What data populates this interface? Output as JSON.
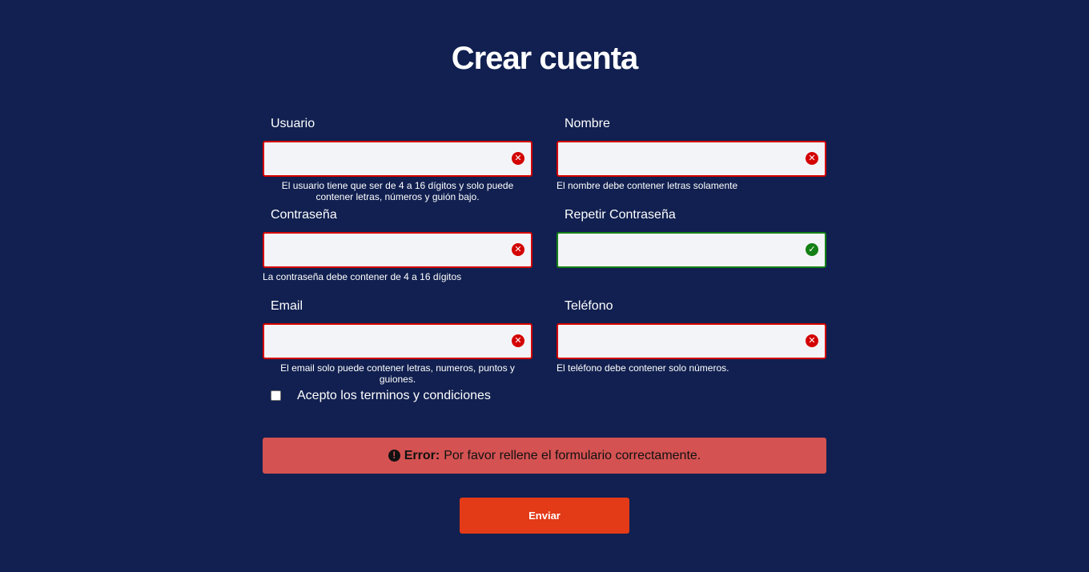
{
  "page": {
    "title": "Crear cuenta"
  },
  "fields": {
    "usuario": {
      "label": "Usuario",
      "value": "",
      "hint": "El usuario tiene que ser de 4 a 16 dígitos y solo puede contener letras, números y guión bajo.",
      "status": "error"
    },
    "nombre": {
      "label": "Nombre",
      "value": "",
      "hint": "El nombre debe contener letras solamente",
      "status": "error"
    },
    "password": {
      "label": "Contraseña",
      "value": "",
      "hint": "La contraseña debe contener de 4 a 16 dígitos",
      "status": "error"
    },
    "password2": {
      "label": "Repetir Contraseña",
      "value": "",
      "status": "valid"
    },
    "email": {
      "label": "Email",
      "value": "",
      "hint": "El email solo puede contener letras, numeros, puntos y guiones.",
      "status": "error"
    },
    "telefono": {
      "label": "Teléfono",
      "value": "",
      "hint": "El teléfono debe contener solo números.",
      "status": "error"
    }
  },
  "terms": {
    "label": "Acepto los terminos y condiciones",
    "checked": false
  },
  "error_message": {
    "icon": "exclamation-circle-icon",
    "label": "Error:",
    "text": "Por favor rellene el formulario correctamente."
  },
  "submit": {
    "label": "Enviar"
  },
  "colors": {
    "background": "#112050",
    "error_border": "#d40000",
    "valid_border": "#138015",
    "error_box": "#d45252",
    "submit_button": "#e33a17"
  }
}
